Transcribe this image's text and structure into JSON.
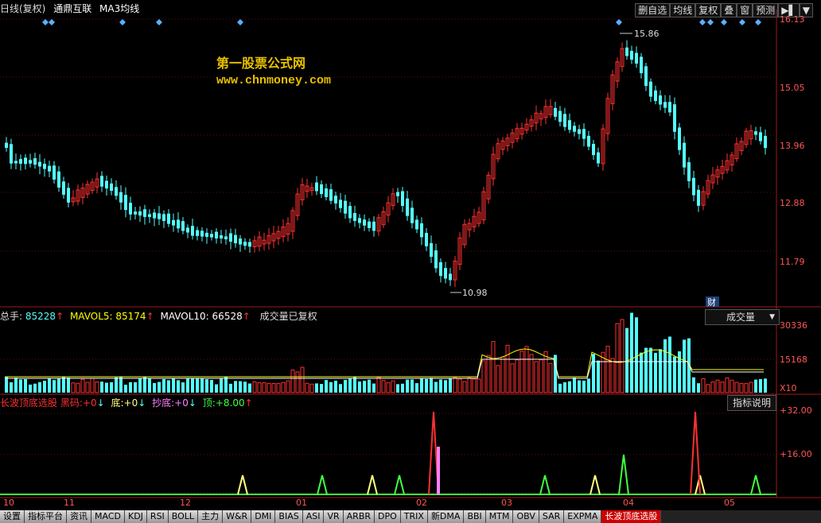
{
  "header": {
    "period": "日线(复权)",
    "stock_name": "通鼎互联",
    "ma_label": "MA3均线",
    "toolbar": [
      "删自选",
      "均线",
      "复权",
      "叠",
      "窗",
      "预测"
    ]
  },
  "price_axis": [
    "16.13",
    "15.05",
    "13.96",
    "12.88",
    "11.79"
  ],
  "price_annotations": {
    "high": "15.86",
    "low": "10.98",
    "fin_badge": "财"
  },
  "watermark": {
    "line1": "第一股票公式网",
    "line2": "www.chnmoney.com"
  },
  "volume_panel": {
    "total_label": "总手:",
    "total_value": "85228",
    "mavol5_label": "MAVOL5:",
    "mavol5_value": "85174",
    "mavol10_label": "MAVOL10:",
    "mavol10_value": "66528",
    "note": "成交量已复权",
    "selector": "成交量",
    "axis": [
      "30336",
      "15168",
      "X10"
    ]
  },
  "indicator_panel": {
    "name": "长波顶底选股",
    "black_label": "黑码:",
    "black_value": "+0",
    "bottom_label": "底:",
    "bottom_value": "+0",
    "chaodi_label": "抄底:",
    "chaodi_value": "+0",
    "top_label": "顶:",
    "top_value": "+8.00",
    "explain_button": "指标说明",
    "axis": [
      "+32.00",
      "+16.00"
    ]
  },
  "date_axis": [
    "10",
    "11",
    "12",
    "01",
    "02",
    "03",
    "04",
    "05"
  ],
  "tabs": [
    "设置",
    "指标平台",
    "资讯",
    "MACD",
    "KDJ",
    "RSI",
    "BOLL",
    "主力",
    "W&R",
    "DMI",
    "BIAS",
    "ASI",
    "VR",
    "ARBR",
    "DPO",
    "TRIX",
    "新DMA",
    "BBI",
    "MTM",
    "OBV",
    "SAR",
    "EXPMA",
    "长波顶底选股"
  ],
  "colors": {
    "up": "#ff3030",
    "down": "#54fcfc",
    "axis": "#ff3030",
    "grid": "#8a1515"
  }
}
